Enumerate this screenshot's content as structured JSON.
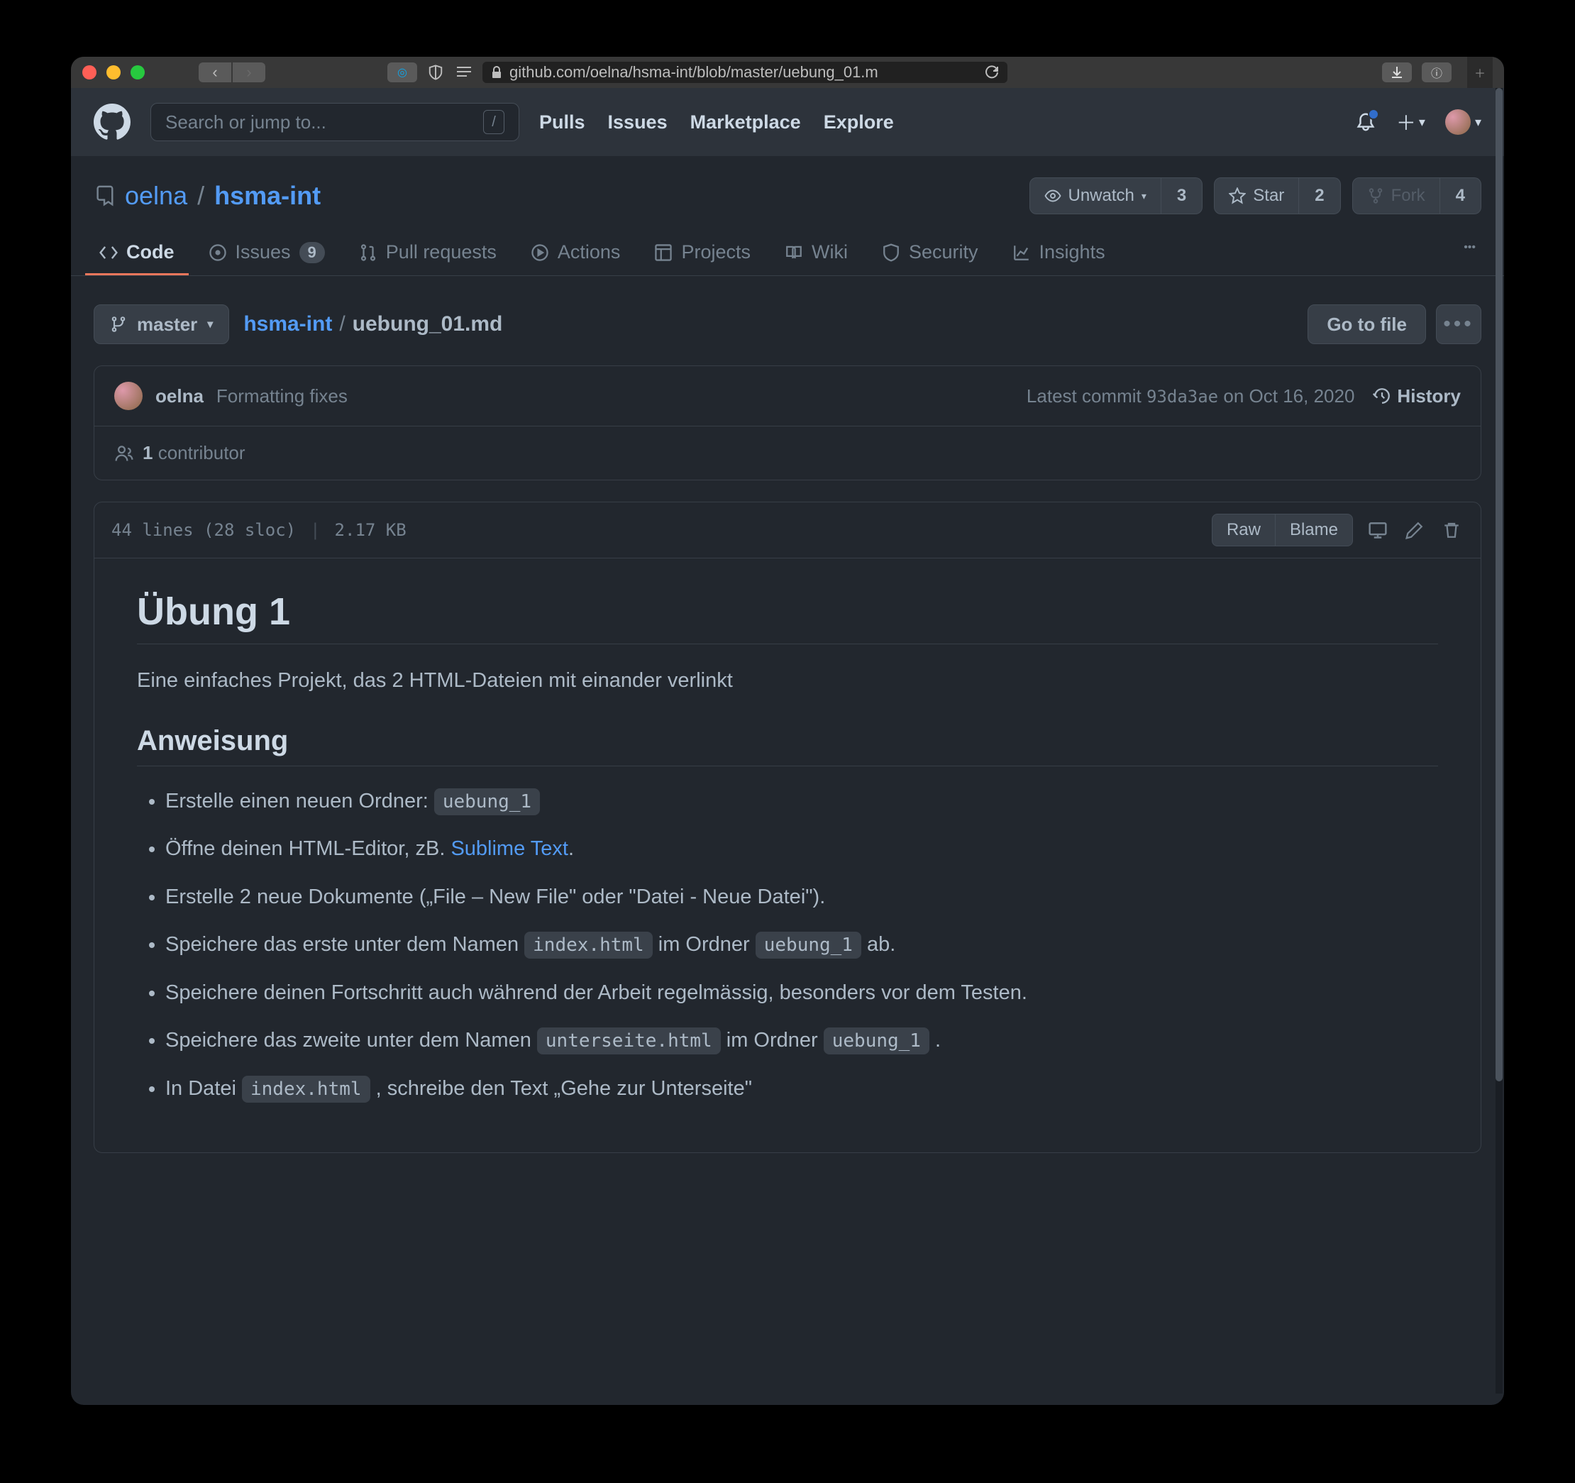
{
  "browser": {
    "url": "github.com/oelna/hsma-int/blob/master/uebung_01.m"
  },
  "header": {
    "search_placeholder": "Search or jump to...",
    "search_kbd": "/",
    "nav": {
      "pulls": "Pulls",
      "issues": "Issues",
      "marketplace": "Marketplace",
      "explore": "Explore"
    }
  },
  "repo": {
    "owner": "oelna",
    "name": "hsma-int",
    "actions": {
      "unwatch": "Unwatch",
      "unwatch_count": "3",
      "star": "Star",
      "star_count": "2",
      "fork": "Fork",
      "fork_count": "4"
    }
  },
  "tabs": {
    "code": "Code",
    "issues": "Issues",
    "issues_count": "9",
    "pulls": "Pull requests",
    "actions": "Actions",
    "projects": "Projects",
    "wiki": "Wiki",
    "security": "Security",
    "insights": "Insights"
  },
  "filebar": {
    "branch": "master",
    "root": "hsma-int",
    "file": "uebung_01.md",
    "goto": "Go to file"
  },
  "commit": {
    "user": "oelna",
    "message": "Formatting fixes",
    "latest_label": "Latest commit",
    "sha": "93da3ae",
    "date_prefix": "on",
    "date": "Oct 16, 2020",
    "history": "History",
    "contributor_count": "1",
    "contributor_text": "contributor"
  },
  "filehead": {
    "lines": "44 lines (28 sloc)",
    "size": "2.17 KB",
    "raw": "Raw",
    "blame": "Blame"
  },
  "md": {
    "h1": "Übung 1",
    "intro": "Eine einfaches Projekt, das 2 HTML-Dateien mit einander verlinkt",
    "h2": "Anweisung",
    "li1_a": "Erstelle einen neuen Ordner: ",
    "li1_code": "uebung_1",
    "li2_a": "Öffne deinen HTML-Editor, zB. ",
    "li2_link": "Sublime Text",
    "li2_b": ".",
    "li3": "Erstelle 2 neue Dokumente („File – New File\" oder \"Datei - Neue Datei\").",
    "li4_a": "Speichere das erste unter dem Namen ",
    "li4_code1": "index.html",
    "li4_b": " im Ordner ",
    "li4_code2": "uebung_1",
    "li4_c": " ab.",
    "li5": "Speichere deinen Fortschritt auch während der Arbeit regelmässig, besonders vor dem Testen.",
    "li6_a": "Speichere das zweite unter dem Namen ",
    "li6_code1": "unterseite.html",
    "li6_b": " im Ordner ",
    "li6_code2": "uebung_1",
    "li6_c": " .",
    "li7_a": "In Datei ",
    "li7_code": "index.html",
    "li7_b": " , schreibe den Text „Gehe zur Unterseite\""
  }
}
